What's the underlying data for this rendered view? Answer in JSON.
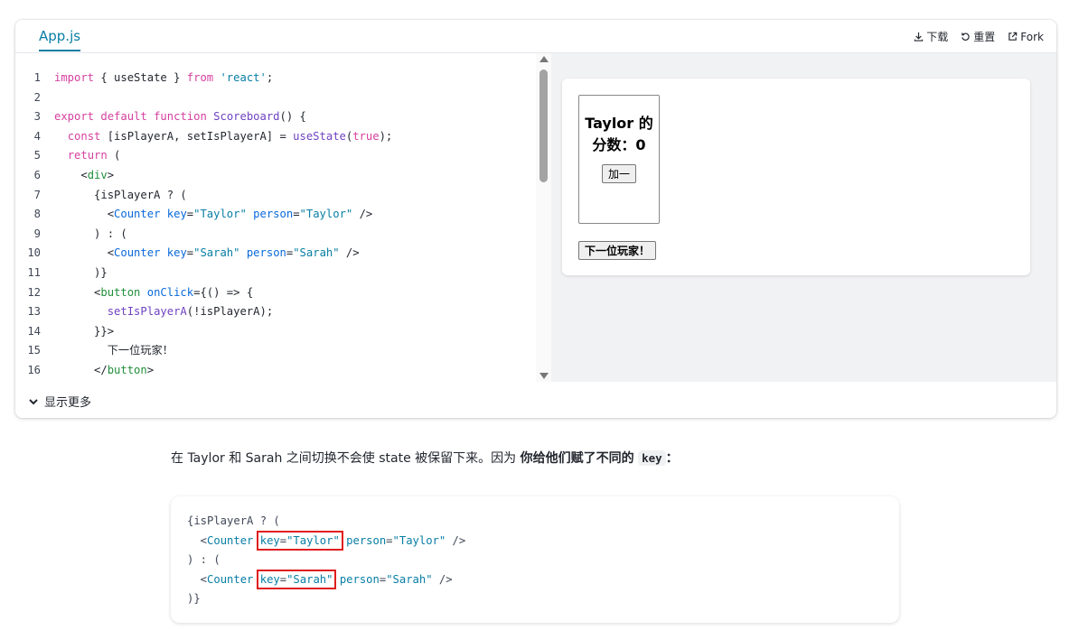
{
  "sandpack": {
    "file_tab": "App.js",
    "actions": [
      {
        "label": "下载",
        "icon": "download-icon"
      },
      {
        "label": "重置",
        "icon": "reset-icon"
      },
      {
        "label": "Fork",
        "icon": "external-link-icon"
      }
    ],
    "line_numbers": [
      "1",
      "2",
      "3",
      "4",
      "5",
      "6",
      "7",
      "8",
      "9",
      "10",
      "11",
      "12",
      "13",
      "14",
      "15",
      "16"
    ],
    "code": {
      "l1": {
        "a": "import",
        "b": " { useState } ",
        "c": "from",
        "d": " ",
        "e": "'react'",
        "f": ";"
      },
      "l3": {
        "a": "export",
        "b": " ",
        "c": "default",
        "d": " ",
        "e": "function",
        "f": " ",
        "g": "Scoreboard",
        "h": "() {"
      },
      "l4": {
        "a": "  ",
        "b": "const",
        "c": " [isPlayerA, setIsPlayerA] = ",
        "d": "useState",
        "e": "(",
        "f": "true",
        "g": ");"
      },
      "l5": {
        "a": "  ",
        "b": "return",
        "c": " ("
      },
      "l6": {
        "a": "    <",
        "b": "div",
        "c": ">"
      },
      "l7": {
        "a": "      {isPlayerA ? ("
      },
      "l8": {
        "a": "        <",
        "b": "Counter",
        "c": " ",
        "d": "key",
        "e": "=",
        "f": "\"Taylor\"",
        "g": " ",
        "h": "person",
        "i": "=",
        "j": "\"Taylor\"",
        "k": " />"
      },
      "l9": {
        "a": "      ) : ("
      },
      "l10": {
        "a": "        <",
        "b": "Counter",
        "c": " ",
        "d": "key",
        "e": "=",
        "f": "\"Sarah\"",
        "g": " ",
        "h": "person",
        "i": "=",
        "j": "\"Sarah\"",
        "k": " />"
      },
      "l11": {
        "a": "      )}"
      },
      "l12": {
        "a": "      <",
        "b": "button",
        "c": " ",
        "d": "onClick",
        "e": "={() => {"
      },
      "l13": {
        "a": "        ",
        "b": "setIsPlayerA",
        "c": "(!isPlayerA);"
      },
      "l14": {
        "a": "      }}>"
      },
      "l15": {
        "a": "        ",
        "b": "下一位玩家！"
      },
      "l16": {
        "a": "      </",
        "b": "button",
        "c": ">"
      }
    },
    "preview": {
      "counter_title": "Taylor 的分数：0",
      "add_button": "加一",
      "next_button": "下一位玩家！"
    },
    "show_more": "显示更多"
  },
  "paragraph": {
    "text": "在 Taylor 和 Sarah 之间切换不会使 state 被保留下来。因为 ",
    "bold": "你给他们赋了不同的",
    "code": "key",
    "end": "："
  },
  "snippet": {
    "l1": "{isPlayerA ? (",
    "l2": {
      "a": "  <",
      "b": "Counter",
      "c": " ",
      "d": "key",
      "e": "=",
      "f": "\"Taylor\"",
      "g": " ",
      "h": "person",
      "i": "=",
      "j": "\"Taylor\"",
      "k": " />"
    },
    "l3": ") : (",
    "l4": {
      "a": "  <",
      "b": "Counter",
      "c": " ",
      "d": "key",
      "e": "=",
      "f": "\"Sarah\"",
      "g": " ",
      "h": "person",
      "i": "=",
      "j": "\"Sarah\"",
      "k": " />"
    },
    "l5": ")}"
  }
}
